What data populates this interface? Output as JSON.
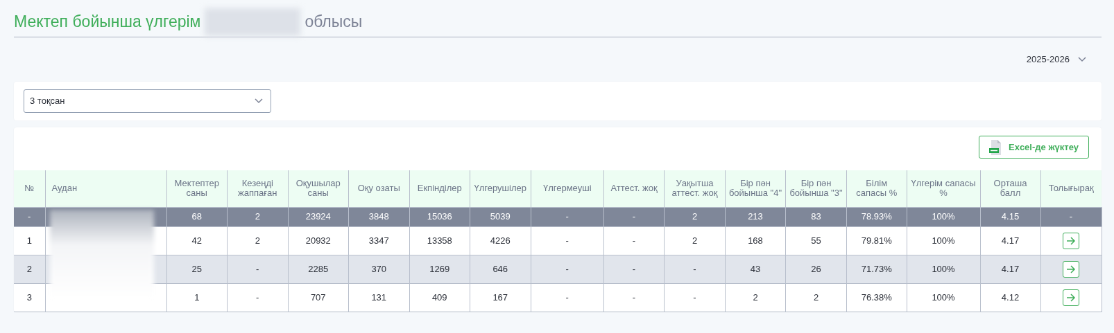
{
  "page_title": {
    "text": "Мектеп бойынша үлгерім",
    "suffix": "облысы"
  },
  "year_selector": {
    "value": "2025-2026"
  },
  "quarter_select": {
    "value": "3 тоқсан"
  },
  "export_button": {
    "label": "Excel-де жүктеу"
  },
  "table": {
    "columns": [
      "№",
      "Аудан",
      "Мектептер саны",
      "Кезеңді жаппаған",
      "Оқушылар саны",
      "Оқу озаты",
      "Екпінділер",
      "Үлгерушілер",
      "Үлгермеуші",
      "Аттест. жоқ",
      "Уақытша аттест. жоқ",
      "Бір пән бойынша \"4\"",
      "Бір пән бойынша \"3\"",
      "Білім сапасы %",
      "Үлгерім сапасы %",
      "Орташа балл",
      "Толығырақ"
    ],
    "rows": [
      {
        "kind": "total",
        "highlighted": false,
        "number": "-",
        "values": [
          "68",
          "2",
          "23924",
          "3848",
          "15036",
          "5039",
          "-",
          "-",
          "2",
          "213",
          "83",
          "78.93%",
          "100%",
          "4.15"
        ],
        "action": "-"
      },
      {
        "kind": "data",
        "highlighted": false,
        "number": "1",
        "values": [
          "42",
          "2",
          "20932",
          "3347",
          "13358",
          "4226",
          "-",
          "-",
          "2",
          "168",
          "55",
          "79.81%",
          "100%",
          "4.17"
        ]
      },
      {
        "kind": "data",
        "highlighted": true,
        "number": "2",
        "values": [
          "25",
          "-",
          "2285",
          "370",
          "1269",
          "646",
          "-",
          "-",
          "-",
          "43",
          "26",
          "71.73%",
          "100%",
          "4.17"
        ]
      },
      {
        "kind": "data",
        "highlighted": false,
        "number": "3",
        "values": [
          "1",
          "-",
          "707",
          "131",
          "409",
          "167",
          "-",
          "-",
          "-",
          "2",
          "2",
          "76.38%",
          "100%",
          "4.12"
        ]
      }
    ]
  }
}
